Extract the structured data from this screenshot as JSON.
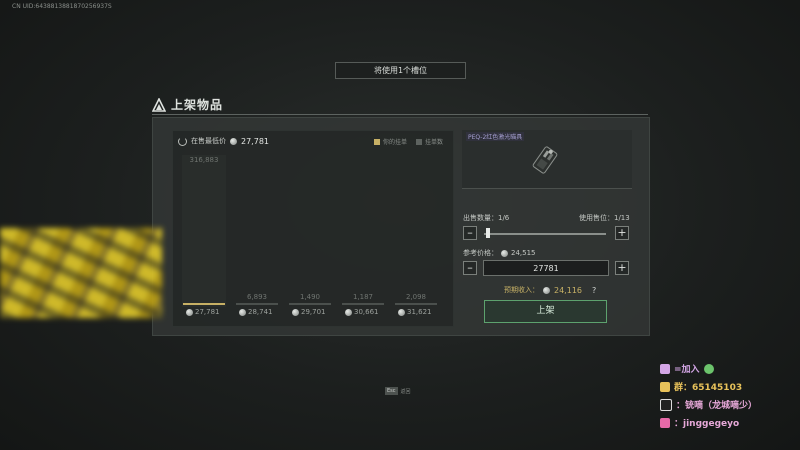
{
  "uid": "CN UID:6438813881870256937S",
  "slot_banner": "将使用1个槽位",
  "section_title": "上架物品",
  "chart": {
    "lowest_label": "在售最低价",
    "lowest_price": "27,781",
    "legend": [
      {
        "label": "你的挂单",
        "color": "#c7b065"
      },
      {
        "label": "挂单数",
        "color": "#5d625f"
      }
    ],
    "bars": [
      {
        "count": "316,883",
        "price": "27,781",
        "highlight": true
      },
      {
        "count": "6,893",
        "price": "28,741",
        "highlight": false
      },
      {
        "count": "1,490",
        "price": "29,701",
        "highlight": false
      },
      {
        "count": "1,187",
        "price": "30,661",
        "highlight": false
      },
      {
        "count": "2,098",
        "price": "31,621",
        "highlight": false
      }
    ]
  },
  "item": {
    "name": "PEQ-2红色激光瞄具"
  },
  "sell_qty": {
    "label": "出售数量：",
    "value": "1/6"
  },
  "slots_used": {
    "label": "使用售位：",
    "value": "1/13"
  },
  "ref_price": {
    "label": "参考价格：",
    "value": "24,515"
  },
  "price_input": "27781",
  "expected_income": {
    "label": "预期收入：",
    "value": "24,116",
    "help": "?"
  },
  "list_button": "上架",
  "esc_hint": {
    "key": "Esc",
    "label": "返回"
  },
  "promo": [
    {
      "text": "=加入",
      "color": "#d4a6e6"
    },
    {
      "text": "群：65145103",
      "color": "#e8c25a"
    },
    {
      "text": "：铳嘀（龙城嘀少）",
      "color": "#e6a8d8"
    },
    {
      "text": "：jinggegeyo",
      "color": "#e6a8d8"
    }
  ]
}
